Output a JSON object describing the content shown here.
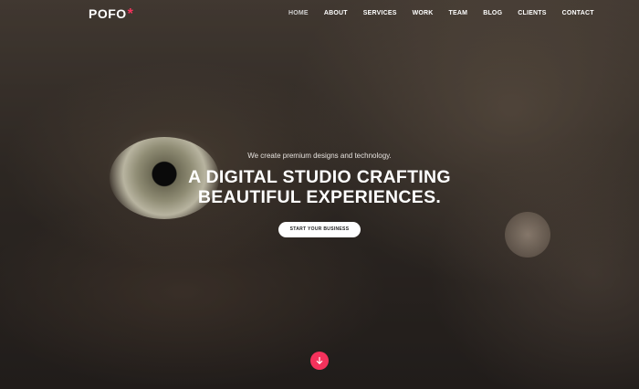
{
  "header": {
    "logo_text": "POFO",
    "logo_mark": "*",
    "menu": [
      "HOME",
      "ABOUT",
      "SERVICES",
      "WORK",
      "TEAM",
      "BLOG",
      "CLIENTS",
      "CONTACT"
    ],
    "active_item": "HOME"
  },
  "hero": {
    "tagline": "We create premium designs and technology.",
    "headline_line1": "A DIGITAL STUDIO CRAFTING",
    "headline_line2": "BEAUTIFUL EXPERIENCES.",
    "cta_label": "START YOUR BUSINESS",
    "scroll_icon": "arrow-down-icon"
  },
  "colors": {
    "accent": "#f5325c",
    "text": "#ffffff"
  }
}
